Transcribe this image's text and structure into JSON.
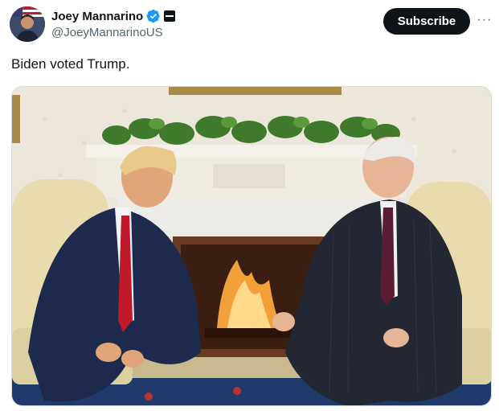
{
  "author": {
    "display_name": "Joey Mannarino",
    "handle": "@JoeyMannarinoUS",
    "verified": true
  },
  "actions": {
    "subscribe_label": "Subscribe",
    "more_label": "···"
  },
  "post": {
    "text": "Biden voted Trump."
  },
  "colors": {
    "verified_blue": "#1d9bf0",
    "text_primary": "#0f1419",
    "text_secondary": "#536471",
    "button_dark": "#0f1419"
  },
  "icons": {
    "verified": "verified-badge-icon",
    "affiliate": "affiliate-badge-icon",
    "more": "more-options-icon"
  }
}
